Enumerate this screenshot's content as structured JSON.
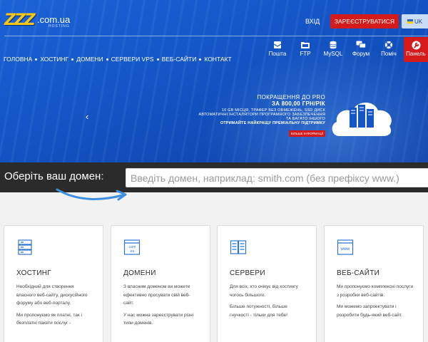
{
  "header": {
    "logo": {
      "brand": "ZZZ",
      "domain": ".com.ua",
      "sub": "HOSTING"
    },
    "login": "ВХІД",
    "register": "ЗАРЕЄСТРУВАТИСЯ",
    "lang": "UK"
  },
  "nav": [
    "ГОЛОВНА",
    "ХОСТИНГ",
    "ДОМЕНИ",
    "СЕРВЕРИ VPS",
    "ВЕБ-САЙТИ",
    "КОНТАКТ"
  ],
  "tools": [
    {
      "label": "Пошта",
      "icon": "mail-icon"
    },
    {
      "label": "FTP",
      "icon": "folder-icon"
    },
    {
      "label": "MySQL",
      "icon": "database-icon"
    },
    {
      "label": "Форум",
      "icon": "forum-icon"
    },
    {
      "label": "Поміч",
      "icon": "lifebuoy-icon"
    },
    {
      "label": "Панель",
      "icon": "wrench-icon"
    }
  ],
  "promo": {
    "line1": "ПОКРАЩЕННЯ ДО PRO",
    "line2": "ЗА 800,00 ГРН/РІК",
    "line3": "10 GB МІСЦЯ, ТРАФЕР БЕЗ ОБМЕЖЕНЬ, SSD ДИСК",
    "line4": "АВТОМАТИЧНІ ІНСТАЛЯТОРИ ПРОГРАМНОГО ЗАБЕЗПЕЧЕННЯ ТА БАГАТО ІНШОГО",
    "line5": "ОТРИМАЙТЕ НАЙКРАЩУ ПРЕМІАЛЬНУ ПІДТРИМКУ",
    "more": "БІЛЬШЕ ІНФОРМАЦІЇ",
    "prev_arrow": "‹"
  },
  "domain_search": {
    "label": "Оберіть ваш домен:",
    "placeholder": "Введіть домен, наприклад: smith.com (без префіксу www.)"
  },
  "cards": [
    {
      "icon": "server-list-icon",
      "title": "ХОСТИНГ",
      "p1": "Необхідний для створення власного веб-сайту, дискусійного форуму або веб-порталу.",
      "p2": "Ми пропонуємо як платні, так і безплатні пакети послуг -"
    },
    {
      "icon": "domain-icon",
      "icon_text": ".com .eu",
      "title": "ДОМЕНИ",
      "p1": "З власним доменом ви можете ефективно просувати свій веб-сайт.",
      "p2": "У нас можна зареєструвати різні типи доменів."
    },
    {
      "icon": "servers-icon",
      "title": "СЕРВЕРИ",
      "p1": "Для всіх, хто очікує від хостингу чогось більшого.",
      "p2": "Більше потужності, більше гнучкості - тільки для тебе!"
    },
    {
      "icon": "www-icon",
      "icon_text": "www",
      "title": "ВЕБ-САЙТИ",
      "p1": "Ми пропонуємо комплексні послуги з розробки веб-сайтів.",
      "p2": "Ми можемо запроектувати і розробити будь-який веб-сайт."
    }
  ],
  "colors": {
    "brand_blue": "#1456c8",
    "accent_red": "#d41a1a",
    "logo_yellow": "#f5c518",
    "dark_bar": "#2b2b2b"
  }
}
